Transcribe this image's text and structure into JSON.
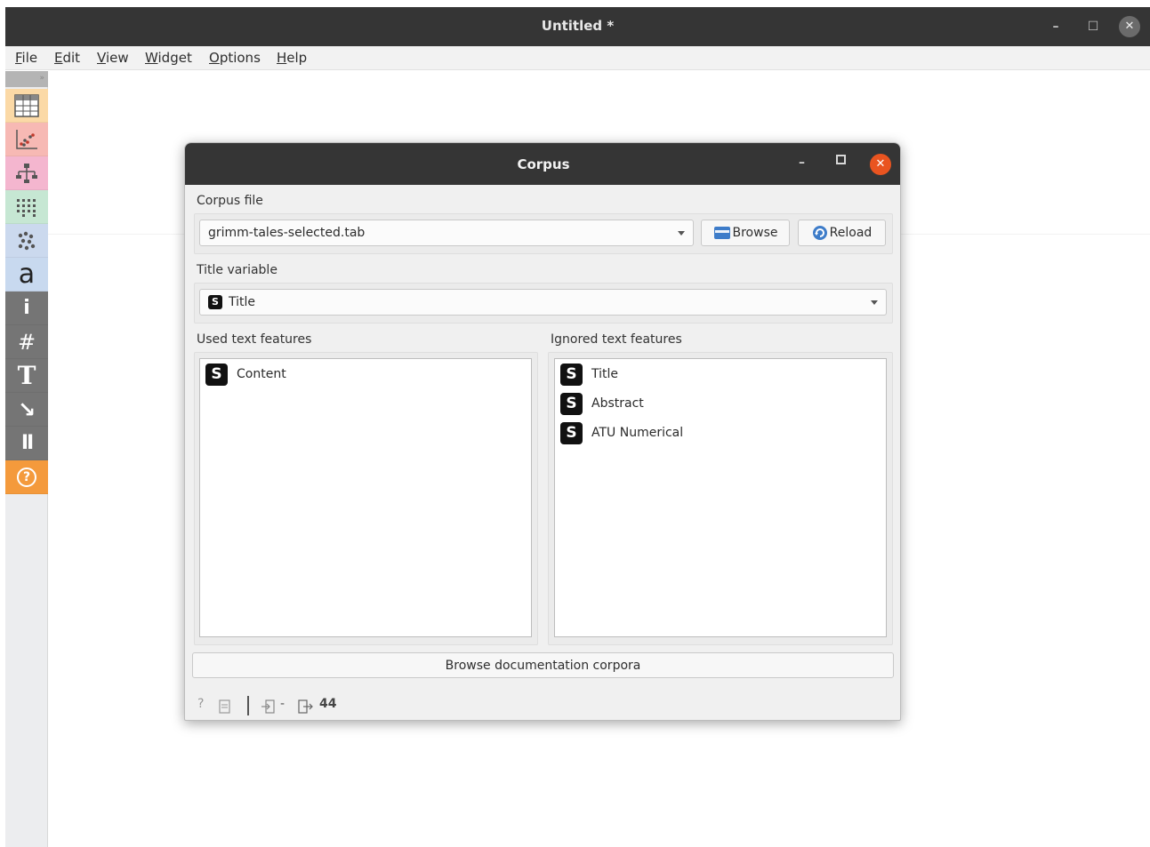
{
  "window": {
    "title": "Untitled *",
    "controls": {
      "minimize": "–",
      "maximize": "☐",
      "close": "✕"
    }
  },
  "menubar": [
    {
      "accel": "F",
      "rest": "ile"
    },
    {
      "accel": "E",
      "rest": "dit"
    },
    {
      "accel": "V",
      "rest": "iew"
    },
    {
      "accel": "W",
      "rest": "idget"
    },
    {
      "accel": "O",
      "rest": "ptions"
    },
    {
      "accel": "H",
      "rest": "elp"
    }
  ],
  "toolbox": {
    "handle": "»",
    "tools": [
      {
        "icon": "data-table-icon",
        "color": "#fbd9a6"
      },
      {
        "icon": "scatter-plot-icon",
        "color": "#f7b9b4"
      },
      {
        "icon": "tree-icon",
        "color": "#f4b6cf"
      },
      {
        "icon": "distance-matrix-icon",
        "color": "#c6e7d3"
      },
      {
        "icon": "clustering-icon",
        "color": "#cbd9ee"
      },
      {
        "icon": "text-a-icon",
        "color": "#c8d9ef",
        "glyph": "a"
      },
      {
        "icon": "info-icon",
        "color": "#757575",
        "glyph": "i"
      },
      {
        "icon": "hash-icon",
        "color": "#757575",
        "glyph": "#"
      },
      {
        "icon": "text-tool-icon",
        "color": "#757575",
        "glyph": "T"
      },
      {
        "icon": "arrow-tool-icon",
        "color": "#757575",
        "glyph": "↘"
      },
      {
        "icon": "pause-icon",
        "color": "#757575",
        "glyph": "II"
      },
      {
        "icon": "help-icon",
        "color": "#f49a3c",
        "glyph": "?"
      }
    ]
  },
  "dialog": {
    "title": "Corpus",
    "controls": {
      "minimize": "–",
      "close": "✕"
    },
    "corpus_file_label": "Corpus file",
    "corpus_file_value": "grimm-tales-selected.tab",
    "browse_label": "Browse",
    "reload_label": "Reload",
    "title_variable_label": "Title variable",
    "title_variable_value": "Title",
    "title_variable_badge": "S",
    "used_label": "Used text features",
    "ignored_label": "Ignored text features",
    "used_features": [
      {
        "badge": "S",
        "name": "Content"
      }
    ],
    "ignored_features": [
      {
        "badge": "S",
        "name": "Title"
      },
      {
        "badge": "S",
        "name": "Abstract"
      },
      {
        "badge": "S",
        "name": "ATU Numerical"
      }
    ],
    "browse_docs_label": "Browse documentation corpora",
    "status": {
      "help": "?",
      "input_value": "-",
      "output_value": "44"
    }
  }
}
